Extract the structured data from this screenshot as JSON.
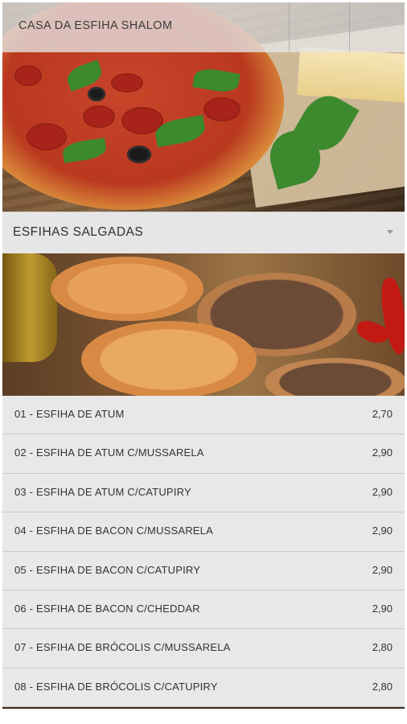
{
  "header": {
    "title": "CASA DA ESFIHA SHALOM"
  },
  "section": {
    "title": "ESFIHAS SALGADAS",
    "icon": "chevron-down-icon"
  },
  "menu": {
    "items": [
      {
        "name": "01 - ESFIHA DE ATUM",
        "price": "2,70"
      },
      {
        "name": "02 - ESFIHA DE ATUM C/MUSSARELA",
        "price": "2,90"
      },
      {
        "name": "03 - ESFIHA DE ATUM C/CATUPIRY",
        "price": "2,90"
      },
      {
        "name": "04 - ESFIHA DE BACON C/MUSSARELA",
        "price": "2,90"
      },
      {
        "name": "05 - ESFIHA DE BACON C/CATUPIRY",
        "price": "2,90"
      },
      {
        "name": "06 - ESFIHA DE BACON C/CHEDDAR",
        "price": "2,90"
      },
      {
        "name": "07 - ESFIHA DE BRÓCOLIS C/MUSSARELA",
        "price": "2,80"
      },
      {
        "name": "08 - ESFIHA DE BRÓCOLIS C/CATUPIRY",
        "price": "2,80"
      }
    ]
  },
  "colors": {
    "header_bg": "#e6e6e6",
    "row_bg": "#e8e8e8",
    "text": "#333333",
    "divider": "#c9c9c9"
  }
}
